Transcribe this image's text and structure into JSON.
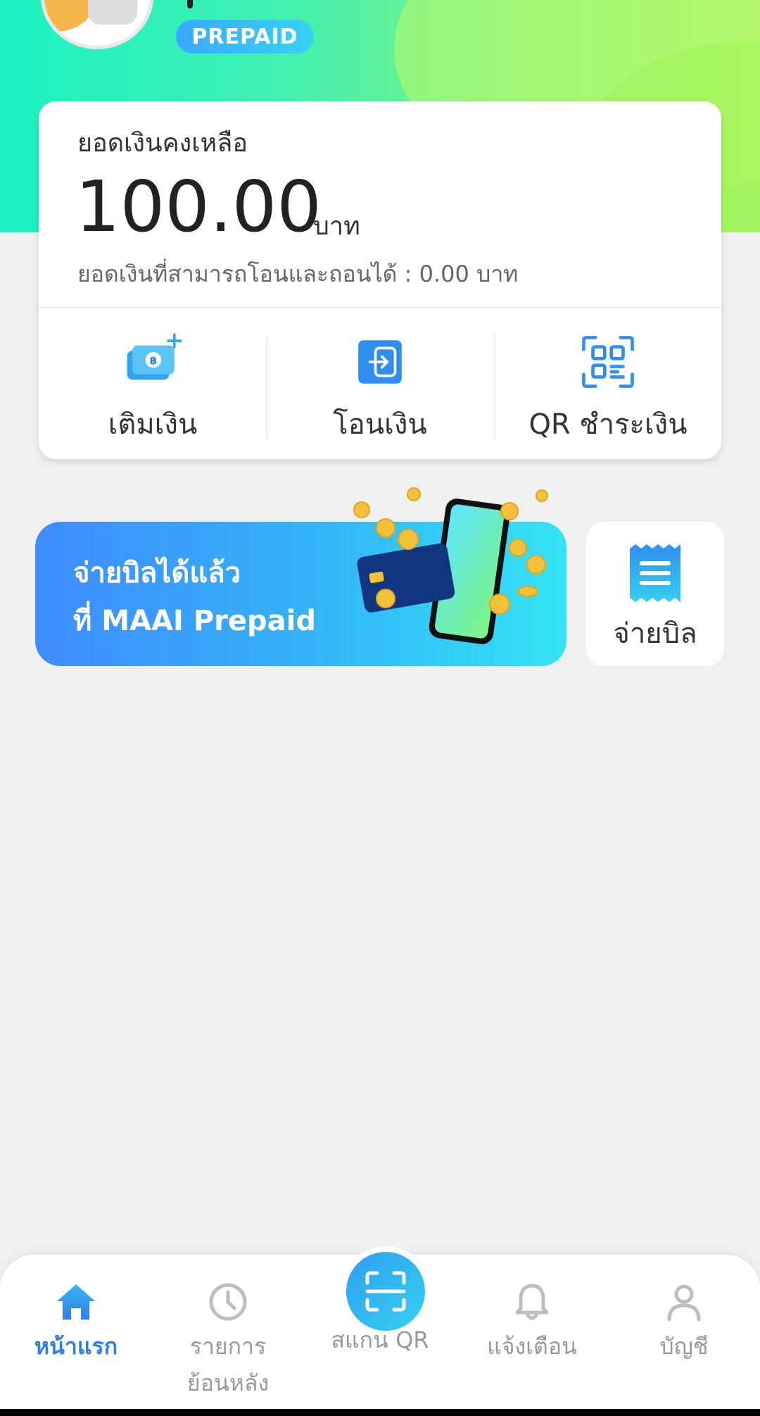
{
  "header": {
    "badge": "PREPAID"
  },
  "balance": {
    "label": "ยอดเงินคงเหลือ",
    "amount": "100.00",
    "unit": "บาท",
    "transferable": "ยอดเงินที่สามารถโอนและถอนได้ : 0.00 บาท"
  },
  "actions": [
    {
      "label": "เติมเงิน",
      "icon": "top-up-icon"
    },
    {
      "label": "โอนเงิน",
      "icon": "transfer-icon"
    },
    {
      "label": "QR ชำระเงิน",
      "icon": "qr-pay-icon"
    }
  ],
  "promo": {
    "line1": "จ่ายบิลได้แล้ว",
    "line2": "ที่ MAAI Prepaid"
  },
  "paybill": {
    "label": "จ่ายบิล",
    "icon": "bill-icon"
  },
  "nav": {
    "home": "หน้าแรก",
    "history_line1": "รายการ",
    "history_line2": "ย้อนหลัง",
    "scan": "สแกน QR",
    "notifications": "แจ้งเตือน",
    "account": "บัญชี"
  },
  "colors": {
    "accent": "#2f7fe6",
    "header_start": "#1df2c2",
    "header_end": "#a9f567",
    "promo_start": "#3f8bff",
    "promo_end": "#36e3f6"
  }
}
